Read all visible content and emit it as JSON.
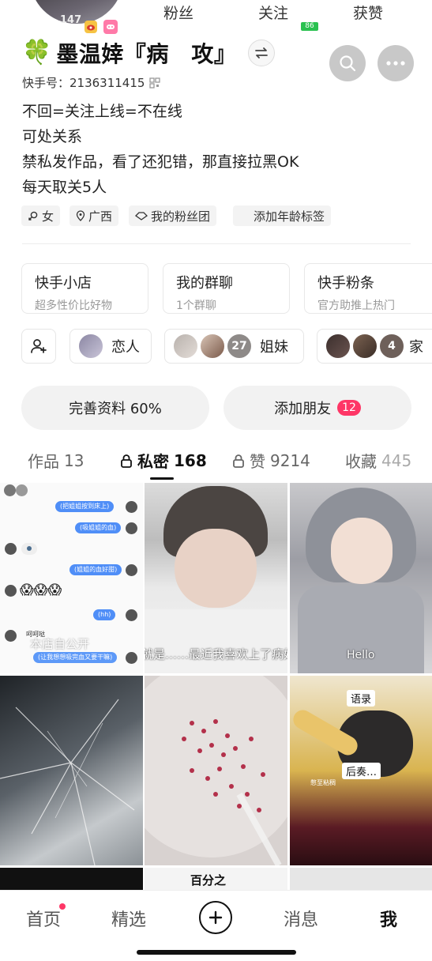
{
  "header": {
    "avatar_count": "147",
    "stats": [
      {
        "label": "粉丝"
      },
      {
        "label": "关注",
        "badge": "86"
      },
      {
        "label": "获赞"
      }
    ]
  },
  "profile": {
    "name": "墨温婞『病　攻』",
    "clover_icon": "🍀",
    "kuaishou_label": "快手号：2136311415",
    "bio": [
      "不回=关注上线=不在线",
      "可处关系",
      "禁私发作品，看了还犯错，那直接拉黑OK",
      "每天取关5人"
    ],
    "tags": [
      "女",
      "广西",
      "我的粉丝团",
      "添加年龄标签"
    ]
  },
  "cards": [
    {
      "title": "快手小店",
      "sub": "超多性价比好物"
    },
    {
      "title": "我的群聊",
      "sub": "1个群聊"
    },
    {
      "title": "快手粉条",
      "sub": "官方助推上热门"
    }
  ],
  "relations": {
    "lovers": "恋人",
    "sisters_count": "27",
    "sisters": "姐妹",
    "family_count": "4",
    "family": "家"
  },
  "actions": {
    "complete_profile": "完善资料 60%",
    "add_friend": "添加朋友",
    "add_friend_badge": "12"
  },
  "tabs": [
    {
      "label": "作品",
      "count": "13"
    },
    {
      "label": "私密",
      "count": "168"
    },
    {
      "label": "赞",
      "count": "9214"
    },
    {
      "label": "收藏",
      "count": "445"
    }
  ],
  "grid": {
    "chat_bubbles": [
      "(把姐姐按到床上)",
      "(吸姐姐的血)",
      "(姐姐的血好甜)",
      "(hh)"
    ],
    "chat_name": "呵呵哒",
    "chat_input": "(让我想想吸完血又要干嘛)",
    "chat_overlay": "本店自公开",
    "emoji": "😱😱😱",
    "caption_2": "就是……最近我喜欢上了病娇",
    "caption_3": "Hello",
    "caption_6_a": "语录",
    "caption_6_b": "后奏…",
    "caption_6_c": "憋至粘稠",
    "caption_row3": "百分之"
  },
  "nav": {
    "home": "首页",
    "featured": "精选",
    "messages": "消息",
    "me": "我"
  },
  "colors": {
    "accent_red": "#fe3666",
    "green_badge": "#2ac150",
    "chat_blue": "#4f8ef7"
  }
}
